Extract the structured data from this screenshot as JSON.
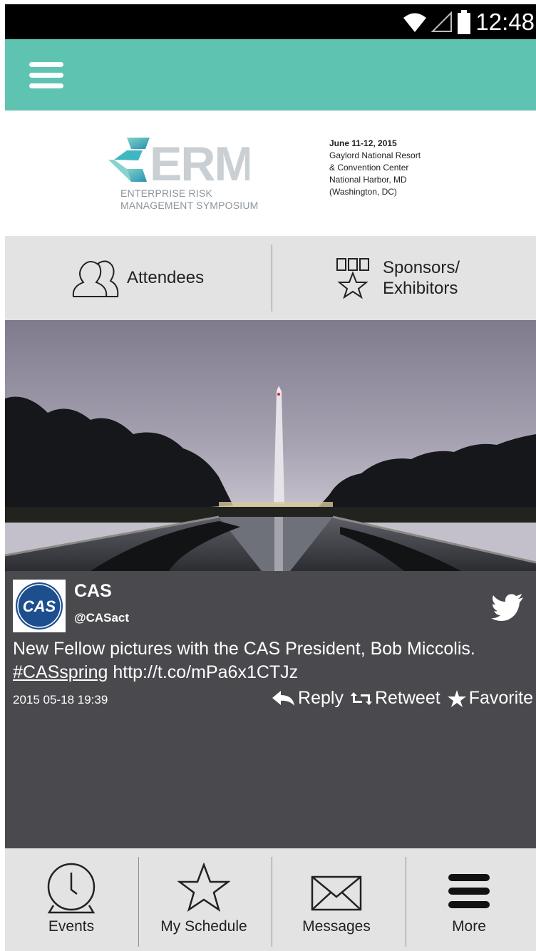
{
  "status_bar": {
    "time": "12:48"
  },
  "app_bar": {
    "menu_icon": "hamburger-icon"
  },
  "banner": {
    "logo_text": "ERM",
    "logo_sub_line1": "ENTERPRISE RISK",
    "logo_sub_line2": "MANAGEMENT SYMPOSIUM",
    "date": "June 11-12, 2015",
    "venue_line1": "Gaylord National Resort",
    "venue_line2": "& Convention Center",
    "venue_line3": "National Harbor, MD",
    "venue_line4": "(Washington, DC)"
  },
  "quick_links": [
    {
      "label": "Attendees",
      "icon": "people-icon"
    },
    {
      "label_line1": "Sponsors/",
      "label_line2": "Exhibitors",
      "icon": "award-star-icon"
    }
  ],
  "tweet": {
    "avatar_text": "CAS",
    "name": "CAS",
    "handle": "@CASact",
    "text_before": "New Fellow pictures with the CAS President, Bob Miccolis. ",
    "hashtag": "#CASspring",
    "link": " http://t.co/mPa6x1CTJz",
    "timestamp": "2015 05-18 19:39",
    "actions": {
      "reply": "Reply",
      "retweet": "Retweet",
      "favorite": "Favorite"
    }
  },
  "bottom_nav": [
    {
      "label": "Events",
      "icon": "clock-icon"
    },
    {
      "label": "My Schedule",
      "icon": "star-icon"
    },
    {
      "label": "Messages",
      "icon": "envelope-icon"
    },
    {
      "label": "More",
      "icon": "menu-icon"
    }
  ],
  "colors": {
    "accent": "#5fc3b2",
    "tweet_bg": "#4a4a4e",
    "nav_bg": "#e3e3e3"
  }
}
